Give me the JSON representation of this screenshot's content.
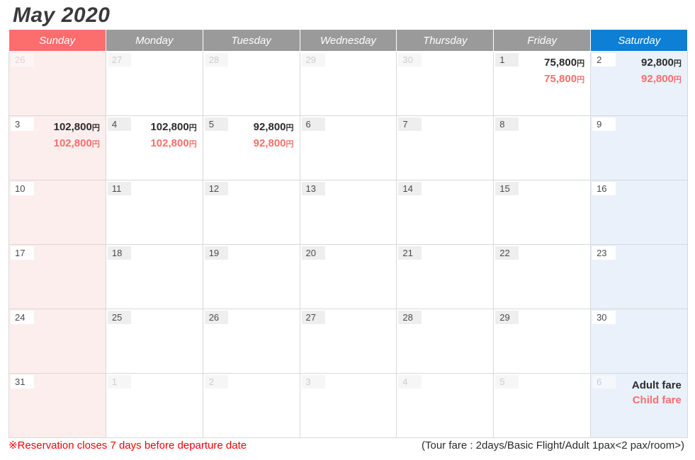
{
  "header": {
    "title": "May 2020"
  },
  "weekdays": [
    {
      "label": "Sunday",
      "kind": "sun"
    },
    {
      "label": "Monday",
      "kind": "wd"
    },
    {
      "label": "Tuesday",
      "kind": "wd"
    },
    {
      "label": "Wednesday",
      "kind": "wd"
    },
    {
      "label": "Thursday",
      "kind": "wd"
    },
    {
      "label": "Friday",
      "kind": "wd"
    },
    {
      "label": "Saturday",
      "kind": "sat"
    }
  ],
  "colors": {
    "sunday_header": "#fc6d6d",
    "saturday_header": "#0d7fd4",
    "weekday_header": "#9a9a9a",
    "sunday_cell": "#fdeeee",
    "saturday_cell": "#eaf1fb",
    "adult_fare_text": "#2b2b2b",
    "child_fare_text": "#fc6d6d",
    "note_text": "#ff0000",
    "grid_line": "#d8d8d8"
  },
  "currency_symbol": "円",
  "weeks": [
    [
      {
        "day": "26",
        "month": "prev",
        "adult": "",
        "child": ""
      },
      {
        "day": "27",
        "month": "prev",
        "adult": "",
        "child": ""
      },
      {
        "day": "28",
        "month": "prev",
        "adult": "",
        "child": ""
      },
      {
        "day": "29",
        "month": "prev",
        "adult": "",
        "child": ""
      },
      {
        "day": "30",
        "month": "prev",
        "adult": "",
        "child": ""
      },
      {
        "day": "1",
        "month": "current",
        "adult": "75,800",
        "child": "75,800"
      },
      {
        "day": "2",
        "month": "current",
        "adult": "92,800",
        "child": "92,800"
      }
    ],
    [
      {
        "day": "3",
        "month": "current",
        "adult": "102,800",
        "child": "102,800"
      },
      {
        "day": "4",
        "month": "current",
        "adult": "102,800",
        "child": "102,800"
      },
      {
        "day": "5",
        "month": "current",
        "adult": "92,800",
        "child": "92,800"
      },
      {
        "day": "6",
        "month": "current",
        "adult": "",
        "child": ""
      },
      {
        "day": "7",
        "month": "current",
        "adult": "",
        "child": ""
      },
      {
        "day": "8",
        "month": "current",
        "adult": "",
        "child": ""
      },
      {
        "day": "9",
        "month": "current",
        "adult": "",
        "child": ""
      }
    ],
    [
      {
        "day": "10",
        "month": "current",
        "adult": "",
        "child": ""
      },
      {
        "day": "11",
        "month": "current",
        "adult": "",
        "child": ""
      },
      {
        "day": "12",
        "month": "current",
        "adult": "",
        "child": ""
      },
      {
        "day": "13",
        "month": "current",
        "adult": "",
        "child": ""
      },
      {
        "day": "14",
        "month": "current",
        "adult": "",
        "child": ""
      },
      {
        "day": "15",
        "month": "current",
        "adult": "",
        "child": ""
      },
      {
        "day": "16",
        "month": "current",
        "adult": "",
        "child": ""
      }
    ],
    [
      {
        "day": "17",
        "month": "current",
        "adult": "",
        "child": ""
      },
      {
        "day": "18",
        "month": "current",
        "adult": "",
        "child": ""
      },
      {
        "day": "19",
        "month": "current",
        "adult": "",
        "child": ""
      },
      {
        "day": "20",
        "month": "current",
        "adult": "",
        "child": ""
      },
      {
        "day": "21",
        "month": "current",
        "adult": "",
        "child": ""
      },
      {
        "day": "22",
        "month": "current",
        "adult": "",
        "child": ""
      },
      {
        "day": "23",
        "month": "current",
        "adult": "",
        "child": ""
      }
    ],
    [
      {
        "day": "24",
        "month": "current",
        "adult": "",
        "child": ""
      },
      {
        "day": "25",
        "month": "current",
        "adult": "",
        "child": ""
      },
      {
        "day": "26",
        "month": "current",
        "adult": "",
        "child": ""
      },
      {
        "day": "27",
        "month": "current",
        "adult": "",
        "child": ""
      },
      {
        "day": "28",
        "month": "current",
        "adult": "",
        "child": ""
      },
      {
        "day": "29",
        "month": "current",
        "adult": "",
        "child": ""
      },
      {
        "day": "30",
        "month": "current",
        "adult": "",
        "child": ""
      }
    ],
    [
      {
        "day": "31",
        "month": "current",
        "adult": "",
        "child": ""
      },
      {
        "day": "1",
        "month": "next",
        "adult": "",
        "child": ""
      },
      {
        "day": "2",
        "month": "next",
        "adult": "",
        "child": ""
      },
      {
        "day": "3",
        "month": "next",
        "adult": "",
        "child": ""
      },
      {
        "day": "4",
        "month": "next",
        "adult": "",
        "child": ""
      },
      {
        "day": "5",
        "month": "next",
        "adult": "",
        "child": ""
      },
      {
        "day": "6",
        "month": "next",
        "adult": "",
        "child": "",
        "legend": true
      }
    ]
  ],
  "legend": {
    "adult_label": "Adult fare",
    "child_label": "Child fare"
  },
  "footer": {
    "note": "※Reservation closes 7 days before departure date",
    "fare_note": "(Tour fare : 2days/Basic Flight/Adult 1pax<2 pax/room>)"
  }
}
